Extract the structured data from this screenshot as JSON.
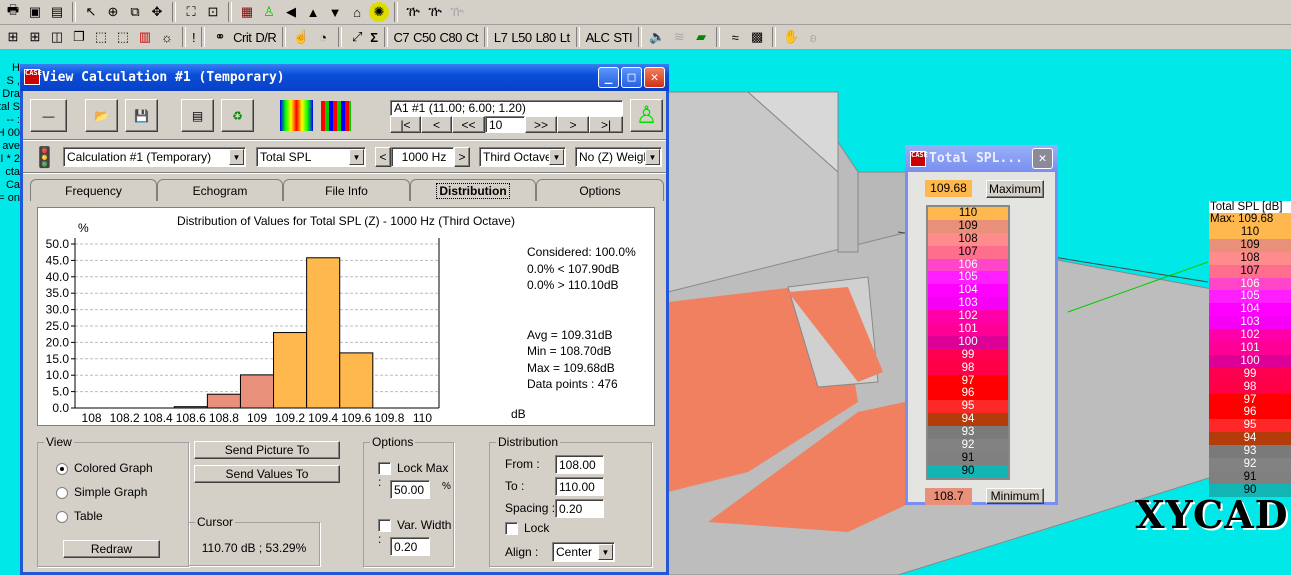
{
  "toolbar1": {
    "icons": [
      "print",
      "copy-picture",
      "save-picture",
      "pointer",
      "crosshair",
      "zoom-window",
      "move",
      "fit",
      "zoom-fit",
      "3d-view",
      "walker",
      "arrow-left",
      "arrow-up",
      "arrow-down",
      "home",
      "sun",
      "sources-on",
      "sources-off",
      "sources-disabled"
    ]
  },
  "toolbar2": {
    "text_buttons": [
      "Crit",
      "D/R",
      "Σ",
      "C7",
      "C50",
      "C80",
      "Ct",
      "L7",
      "L50",
      "L80",
      "Lt",
      "ALC",
      "STI"
    ],
    "exclamation": "!"
  },
  "background_text": [
    "H",
    ", S",
    "Dra",
    "tal S",
    ":  --",
    "00 H",
    "ave",
    "2 * I",
    "cta",
    " Ca",
    "on ="
  ],
  "window": {
    "title": "View Calculation #1 (Temporary)",
    "position_readout": "A1 #1  (11.00; 6.00; 1.20)",
    "nav": {
      "first": "|<",
      "prev": "<",
      "prev_many": "<<",
      "step": "10",
      "next_many": ">>",
      "next": ">",
      "last": ">|"
    },
    "calculation_select": "Calculation #1 (Temporary)",
    "parameter_select": "Total SPL",
    "frequency": "1000 Hz",
    "band_select": "Third Octave",
    "weighting_select": "No (Z) Weigh",
    "tabs": [
      {
        "label": "Frequency"
      },
      {
        "label": "Echogram"
      },
      {
        "label": "File Info"
      },
      {
        "label": "Distribution",
        "active": true
      },
      {
        "label": "Options"
      }
    ],
    "stats": {
      "considered": "Considered: 100.0%",
      "below": "0.0%  < 107.90dB",
      "above": "0.0%  > 110.10dB",
      "avg": "Avg = 109.31dB",
      "min": "Min = 108.70dB",
      "max": "Max = 109.68dB",
      "points": "Data points : 476"
    },
    "view": {
      "label": "View",
      "options": [
        "Colored Graph",
        "Simple Graph",
        "Table"
      ],
      "selected": "Colored Graph",
      "redraw": "Redraw"
    },
    "send_picture": "Send Picture To",
    "send_values": "Send Values To",
    "cursor": {
      "label": "Cursor",
      "value": "110.70 dB ; 53.29%"
    },
    "options": {
      "label": "Options",
      "lock_max": "Lock Max :",
      "lock_max_value": "50.00",
      "percent": "%",
      "var_width": "Var. Width :",
      "var_width_value": "0.20"
    },
    "distribution": {
      "label": "Distribution",
      "from_label": "From :",
      "from": "108.00",
      "to_label": "To :",
      "to": "110.00",
      "spacing_label": "Spacing :",
      "spacing": "0.20",
      "lock": "Lock",
      "align_label": "Align :",
      "align": "Center"
    }
  },
  "chart_data": {
    "type": "bar",
    "title": "Distribution of Values for Total SPL (Z)  - 1000 Hz (Third Octave)",
    "ylabel": "%",
    "xlabel": "dB",
    "categories": [
      "108",
      "108.2",
      "108.4",
      "108.6",
      "108.8",
      "109",
      "109.2",
      "109.4",
      "109.6",
      "109.8",
      "110"
    ],
    "values": [
      0,
      0,
      0,
      0.4,
      4.2,
      10.1,
      23.0,
      45.8,
      16.8,
      0,
      0
    ],
    "bar_colors": [
      "#e8907a",
      "#e8907a",
      "#e8907a",
      "#e8907a",
      "#e8907a",
      "#e8907a",
      "#ffb84d",
      "#ffb84d",
      "#ffb84d",
      "#ffb84d",
      "#ffb84d"
    ],
    "ylim": [
      0,
      50
    ],
    "yticks": [
      "0.0",
      "5.0",
      "10.0",
      "15.0",
      "20.0",
      "25.0",
      "30.0",
      "35.0",
      "40.0",
      "45.0",
      "50.0"
    ],
    "grid": true
  },
  "legend_popup": {
    "title": "Total SPL...",
    "max_value": "109.68",
    "max_button": "Maximum",
    "min_value": "108.7",
    "min_button": "Minimum"
  },
  "color_scale": [
    {
      "label": "110",
      "color": "#ffb84d",
      "text": "#000"
    },
    {
      "label": "109",
      "color": "#e8907a",
      "text": "#000"
    },
    {
      "label": "108",
      "color": "#ff8c8c",
      "text": "#000"
    },
    {
      "label": "107",
      "color": "#ff6e8c",
      "text": "#000"
    },
    {
      "label": "106",
      "color": "#ff46c8",
      "text": "#fff"
    },
    {
      "label": "105",
      "color": "#ff1eff",
      "text": "#fff"
    },
    {
      "label": "104",
      "color": "#ff00ff",
      "text": "#fff"
    },
    {
      "label": "103",
      "color": "#f500f5",
      "text": "#fff"
    },
    {
      "label": "102",
      "color": "#ff00a8",
      "text": "#fff"
    },
    {
      "label": "101",
      "color": "#ff0096",
      "text": "#fff"
    },
    {
      "label": "100",
      "color": "#dc0096",
      "text": "#fff"
    },
    {
      "label": "99",
      "color": "#ff0050",
      "text": "#fff"
    },
    {
      "label": "98",
      "color": "#ff0046",
      "text": "#fff"
    },
    {
      "label": "97",
      "color": "#ff0000",
      "text": "#fff"
    },
    {
      "label": "96",
      "color": "#ff0000",
      "text": "#fff"
    },
    {
      "label": "95",
      "color": "#ff2828",
      "text": "#fff"
    },
    {
      "label": "94",
      "color": "#b43c0a",
      "text": "#fff"
    },
    {
      "label": "93",
      "color": "#7a7a7a",
      "text": "#fff"
    },
    {
      "label": "92",
      "color": "#828282",
      "text": "#fff"
    },
    {
      "label": "91",
      "color": "#808080",
      "text": "#000"
    },
    {
      "label": "90",
      "color": "#12b4b4",
      "text": "#000"
    }
  ],
  "side_legend": {
    "title": "Total SPL [dB]",
    "max": "Max:  109.68"
  },
  "watermark": "XYCAD"
}
